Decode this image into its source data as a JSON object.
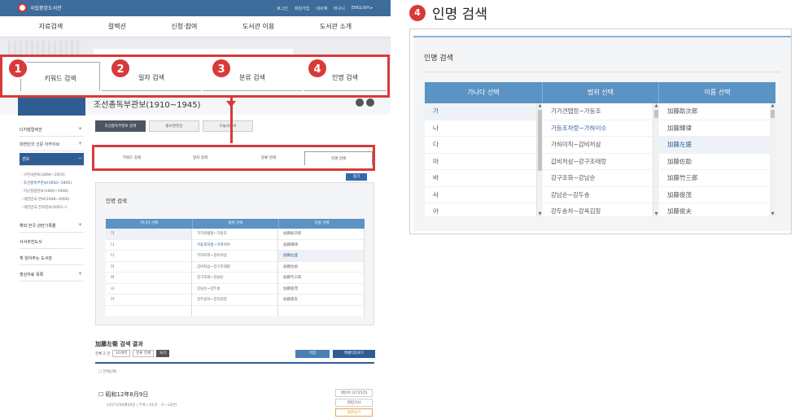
{
  "site": {
    "logo_text": "국립중앙도서관",
    "util_links": [
      "로그인",
      "회원가입",
      "내서재",
      "바구니",
      "ENGLISH ▸"
    ],
    "gnb": [
      "자료검색",
      "컬렉션",
      "신청·참여",
      "도서관 이용",
      "도서관 소개"
    ]
  },
  "big_tabs": [
    {
      "num": "1",
      "label": "키워드 검색"
    },
    {
      "num": "2",
      "label": "일자 검색"
    },
    {
      "num": "3",
      "label": "분류 검색"
    },
    {
      "num": "4",
      "label": "인명 검색"
    }
  ],
  "sidebar": {
    "items": [
      {
        "label": "디지털컬렉션",
        "sign": "+"
      },
      {
        "label": "대한민국 신문 아카이브",
        "sign": "+"
      },
      {
        "label": "관보",
        "sign": "−"
      },
      {
        "label": "해외 한국 관련기록물",
        "sign": "+"
      },
      {
        "label": "사서추천도서",
        "sign": ""
      },
      {
        "label": "책 읽어주는 도서관",
        "sign": ""
      },
      {
        "label": "영상자료 목록",
        "sign": "+"
      }
    ],
    "subitems": [
      "· 구한국관보(1894~1910)",
      "· 조선총독부관보(1910~1945)",
      "· 미군정청관보(1945~1948)",
      "· 대한민국 관보(1948~2000)",
      "· 대한민국 전자관보(2001~)"
    ]
  },
  "content": {
    "title": "조선총독부관보(1910~1945)",
    "subtabs": [
      "조선총독부관보 검색",
      "통보원영상",
      "오늘의관보"
    ],
    "small_tabs": [
      "키워드 검색",
      "일자 검색",
      "분류 검색",
      "인명 검색"
    ],
    "fold_btn": "접기",
    "panel_title": "인명 검색",
    "result_title": "加藤左衛 검색 결과",
    "result_count": "전체 2 건",
    "per_page": "10개씩",
    "sort": "분류 전체",
    "go": "보기",
    "save_btn": "저장",
    "excel_btn": "엑셀다운로드",
    "select_all": "전체선택",
    "item_title": "昭和12年8月9日",
    "item_meta": "1937년08월09일 | 부록 | 61면 · (1~18면)",
    "item_btns": [
      "색인어 (2715건)",
      "관련기사",
      "원문보기"
    ]
  },
  "person_search": {
    "badge": "4",
    "heading": "인명 검색",
    "panel_title": "인명 검색",
    "headers": [
      "가나다 선택",
      "범위 선택",
      "이름 선택"
    ],
    "col1": [
      "가",
      "나",
      "다",
      "마",
      "바",
      "사",
      "아"
    ],
    "col2": [
      "가가견탭랑~가등조",
      "가등조차랑~가하이수",
      "가하미직~감비처삼",
      "갑비처삼~강구조태랑",
      "강구조화~강남순",
      "강남순~강두송",
      "강두송차~강옥김장"
    ],
    "col3": [
      "加藤助次郎",
      "加藤輝律",
      "加藤左盛",
      "加藤佐助",
      "加藤竹三郎",
      "加藤俊茂",
      "加藤俊夫"
    ],
    "selected": {
      "col1": 0,
      "col2": 1,
      "col3": 2
    }
  }
}
